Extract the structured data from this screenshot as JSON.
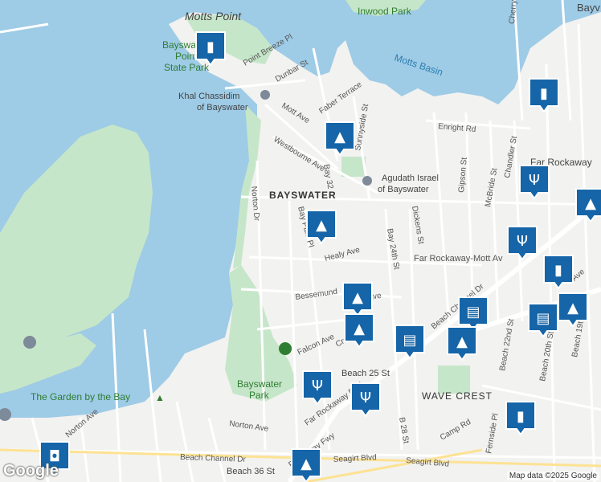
{
  "colors": {
    "water": "#9ecbe6",
    "park": "#c6e6c9",
    "marker": "#1565a8",
    "land": "#f2f2f0",
    "road": "#ffffff"
  },
  "labels": {
    "motts_point": "Motts Point",
    "inwood_park": "Inwood Park",
    "motts_basin": "Motts Basin",
    "bayswater_point_1": "Bayswater",
    "bayswater_point_2": "Point",
    "bayswater_point_3": "State Park",
    "khal_chassidim": "Khal Chassidim",
    "of_bayswater_1": "of Bayswater",
    "agudath_israel": "Agudath Israel",
    "of_bayswater_2": "of Bayswater",
    "bayswater": "BAYSWATER",
    "far_rockaway": "Far Rockaway",
    "wave_crest": "WAVE CREST",
    "bayswater_park_1": "Bayswater",
    "bayswater_park_2": "Park",
    "garden_by_bay": "The Garden by the Bay",
    "beach_25_st": "Beach 25 St",
    "beach_36_st": "Beach 36 St",
    "bayv": "Bayv"
  },
  "streets": {
    "point_breeze": "Point Breeze Pl",
    "dunbar": "Dunbar St",
    "faber": "Faber Terrace",
    "mott": "Mott Ave",
    "westbourne": "Westbourne Ave",
    "sunnyside": "Sunnyside St",
    "bay32": "Bay 32",
    "enright": "Enright Rd",
    "gipson": "Gipson St",
    "mcbride": "McBride St",
    "chandler": "Chandler St",
    "cherry": "Cherry",
    "norton_dr": "Norton Dr",
    "bay_park_pl": "Bay Park Pl",
    "healy": "Healy Ave",
    "bay24": "Bay 24th St",
    "dickens": "Dickens St",
    "far_rockaway_mott": "Far Rockaway-Mott Av",
    "bessemund": "Bessemund",
    "curtis": "Curtis Ave",
    "beach_channel": "Beach Channel Dr",
    "beach_channel_2": "Beach Channel Dr",
    "falcon": "Falcon Ave",
    "cres": "Cres",
    "far_rockaway_blvd": "Far Rockaway Blvd",
    "rockaway_fwy": "Rockaway Fwy",
    "beach22": "Beach 22nd St",
    "beach20": "Beach 20th St",
    "beach19": "Beach 19th St",
    "b28": "B 28 St",
    "camp": "Camp Rd",
    "fernside": "Fernside Pl",
    "seagirt": "Seagirt Blvd",
    "seagirt_2": "Seagirt Blvd",
    "norton_ave": "Norton Ave",
    "norton_ave_2": "Norton Ave",
    "av": "Av",
    "ave": "Ave"
  },
  "markers": [
    {
      "type": "shopping",
      "label": "store"
    },
    {
      "type": "shopping",
      "label": "store"
    },
    {
      "type": "school",
      "label": "school"
    },
    {
      "type": "school",
      "label": "school"
    },
    {
      "type": "restaurant",
      "label": "restaurant"
    },
    {
      "type": "school",
      "label": "school"
    },
    {
      "type": "school",
      "label": "school"
    },
    {
      "type": "grocery",
      "label": "grocery"
    },
    {
      "type": "grocery",
      "label": "grocery"
    },
    {
      "type": "school",
      "label": "school"
    },
    {
      "type": "restaurant",
      "label": "restaurant"
    },
    {
      "type": "restaurant",
      "label": "restaurant"
    },
    {
      "type": "grocery",
      "label": "grocery"
    },
    {
      "type": "school",
      "label": "school"
    },
    {
      "type": "shopping",
      "label": "store"
    },
    {
      "type": "cafe",
      "label": "cafe"
    },
    {
      "type": "school",
      "label": "school"
    },
    {
      "type": "restaurant",
      "label": "restaurant"
    },
    {
      "type": "shopping",
      "label": "store"
    },
    {
      "type": "school",
      "label": "school"
    }
  ],
  "attribution": "Map data ©2025 Google",
  "logo": "Google"
}
